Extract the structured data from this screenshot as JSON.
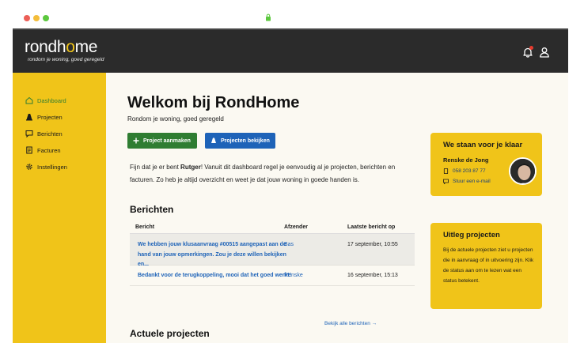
{
  "app": {
    "logo": "rondhome",
    "tagline": "rondom je woning, goed geregeld"
  },
  "icons": {
    "notifications": "bell-icon",
    "account": "user-icon",
    "secure": "lock-icon"
  },
  "colors": {
    "accent_yellow": "#f0c419",
    "topbar": "#2b2b2b",
    "primary_green": "#2f7d32",
    "primary_blue": "#1e63b8",
    "notification_dot": "#e63b2e"
  },
  "sidebar": {
    "items": [
      {
        "label": "Dashboard",
        "icon": "home-icon",
        "active": true
      },
      {
        "label": "Projecten",
        "icon": "cone-icon",
        "active": false
      },
      {
        "label": "Berichten",
        "icon": "message-icon",
        "active": false
      },
      {
        "label": "Facturen",
        "icon": "document-icon",
        "active": false
      },
      {
        "label": "Instellingen",
        "icon": "gear-icon",
        "active": false
      }
    ]
  },
  "main": {
    "title": "Welkom bij RondHome",
    "subtitle": "Rondom je woning, goed geregeld",
    "buttons": {
      "new_project": "Project aanmaken",
      "view_projects": "Projecten bekijken"
    },
    "intro_prefix": "Fijn dat je er bent ",
    "intro_name": "Rutger",
    "intro_suffix": "! Vanuit dit dashboard regel je eenvoudig al je projecten, berichten en facturen. Zo heb je altijd overzicht en weet je dat jouw woning in goede handen is.",
    "messages_title": "Berichten",
    "messages_table": {
      "headers": [
        "Bericht",
        "Afzender",
        "Laatste bericht op"
      ],
      "rows": [
        {
          "message": "We hebben jouw klusaanvraag #00515 aangepast aan de hand van jouw opmerkingen. Zou je deze willen bekijken en...",
          "sender": "Bas",
          "date": "17 september, 10:55"
        },
        {
          "message": "Bedankt voor de terugkoppeling, mooi dat het goed werkt!",
          "sender": "Renske",
          "date": "16 september, 15:13"
        }
      ]
    },
    "view_all_messages": "Bekijk alle berichten →",
    "projects_title": "Actuele projecten"
  },
  "contact_card": {
    "title": "We staan voor je klaar",
    "name": "Renske de Jong",
    "phone": "058 203 87 77",
    "email": "Stuur een e-mail"
  },
  "info_card": {
    "title": "Uitleg projecten",
    "text": "Bij de actuele projecten ziet u projecten die in aanvraag of in uitvoering zijn. Klik de status aan om te lezen wat een status betekent."
  }
}
